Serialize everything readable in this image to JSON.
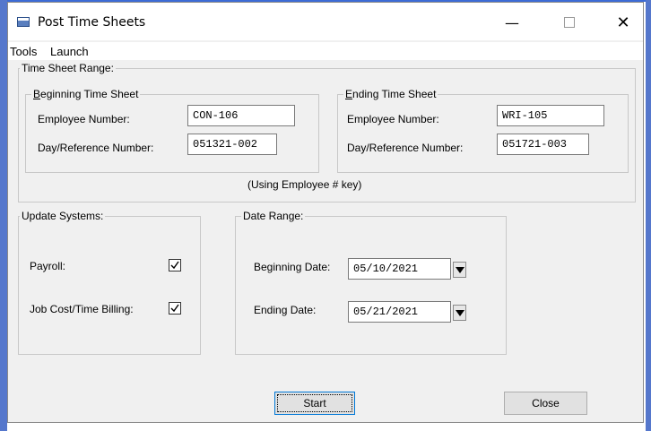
{
  "window": {
    "title": "Post Time Sheets"
  },
  "menu": {
    "items": [
      "Tools",
      "Launch"
    ]
  },
  "time_sheet_range": {
    "title": "Time Sheet Range:",
    "beginning": {
      "title_mnemonic": "B",
      "title_rest": "eginning Time Sheet",
      "employee_label": "Employee Number:",
      "employee_value": "CON-106",
      "dayref_label": "Day/Reference Number:",
      "dayref_value": "051321-002"
    },
    "ending": {
      "title_mnemonic": "E",
      "title_rest": "nding Time Sheet",
      "employee_label": "Employee Number:",
      "employee_value": "WRI-105",
      "dayref_label": "Day/Reference Number:",
      "dayref_value": "051721-003"
    },
    "key_note": "(Using Employee # key)"
  },
  "update_systems": {
    "title": "Update Systems:",
    "payroll_label": "Payroll:",
    "payroll_checked": true,
    "jobcost_label": "Job Cost/Time Billing:",
    "jobcost_checked": true
  },
  "date_range": {
    "title": "Date Range:",
    "beginning_label": "Beginning Date:",
    "beginning_value": "05/10/2021",
    "ending_label": "Ending Date:",
    "ending_value": "05/21/2021"
  },
  "buttons": {
    "start": "Start",
    "close": "Close"
  }
}
